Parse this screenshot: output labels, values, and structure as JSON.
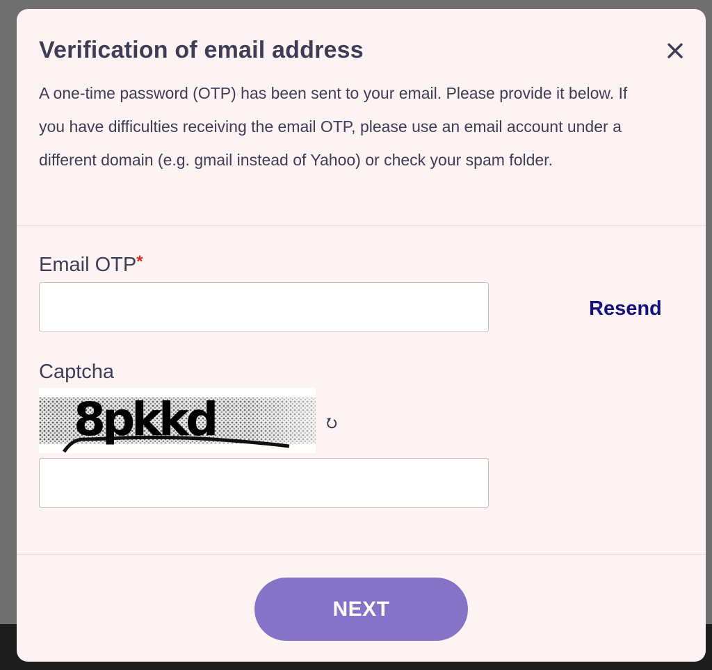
{
  "modal": {
    "title": "Verification of email address",
    "description": "A one-time password (OTP) has been sent to your email. Please provide it below. If you have difficulties receiving the email OTP, please use an email account under a different domain (e.g. gmail instead of Yahoo) or check your spam folder.",
    "close_icon": "close-icon"
  },
  "form": {
    "email_otp": {
      "label": "Email OTP",
      "required_marker": "*",
      "value": "",
      "placeholder": ""
    },
    "resend_label": "Resend",
    "captcha": {
      "label": "Captcha",
      "image_text": "8pkkd",
      "value": "",
      "placeholder": "",
      "refresh_icon": "refresh-icon"
    },
    "next_label": "NEXT"
  },
  "colors": {
    "modal_bg": "#fdf3f3",
    "text": "#3f3d56",
    "link": "#13137f",
    "required": "#e0281c",
    "button": "#8573c8"
  }
}
